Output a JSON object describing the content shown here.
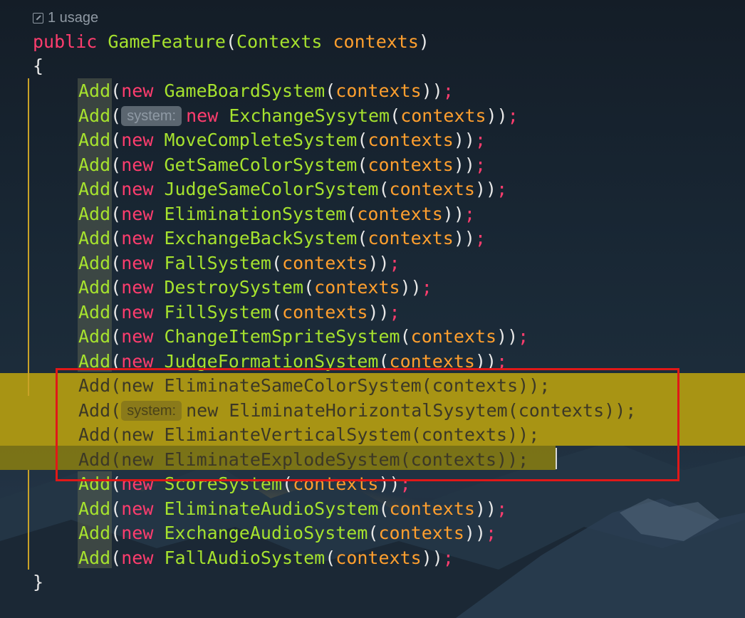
{
  "usage": {
    "icon": "usage-arrow-icon",
    "text": "1 usage"
  },
  "signature": {
    "modifier": "public",
    "name": "GameFeature",
    "param_type": "Contexts",
    "param_name": "contexts",
    "open_paren": "(",
    "close_paren": ")"
  },
  "open_brace": "{",
  "close_brace": "}",
  "statements": [
    {
      "call": "Add",
      "hint": "",
      "kw": "new",
      "system": "GameBoardSystem",
      "arg": "contexts"
    },
    {
      "call": "Add",
      "hint": "system:",
      "kw": "new",
      "system": "ExchangeSysytem",
      "arg": "contexts"
    },
    {
      "call": "Add",
      "hint": "",
      "kw": "new",
      "system": "MoveCompleteSystem",
      "arg": "contexts"
    },
    {
      "call": "Add",
      "hint": "",
      "kw": "new",
      "system": "GetSameColorSystem",
      "arg": "contexts"
    },
    {
      "call": "Add",
      "hint": "",
      "kw": "new",
      "system": "JudgeSameColorSystem",
      "arg": "contexts"
    },
    {
      "call": "Add",
      "hint": "",
      "kw": "new",
      "system": "EliminationSystem",
      "arg": "contexts"
    },
    {
      "call": "Add",
      "hint": "",
      "kw": "new",
      "system": "ExchangeBackSystem",
      "arg": "contexts"
    },
    {
      "call": "Add",
      "hint": "",
      "kw": "new",
      "system": "FallSystem",
      "arg": "contexts"
    },
    {
      "call": "Add",
      "hint": "",
      "kw": "new",
      "system": "DestroySystem",
      "arg": "contexts"
    },
    {
      "call": "Add",
      "hint": "",
      "kw": "new",
      "system": "FillSystem",
      "arg": "contexts"
    },
    {
      "call": "Add",
      "hint": "",
      "kw": "new",
      "system": "ChangeItemSpriteSystem",
      "arg": "contexts"
    },
    {
      "call": "Add",
      "hint": "",
      "kw": "new",
      "system": "JudgeFormationSystem",
      "arg": "contexts"
    },
    {
      "call": "Add",
      "hint": "",
      "kw": "new",
      "system": "EliminateSameColorSystem",
      "arg": "contexts",
      "highlighted": true
    },
    {
      "call": "Add",
      "hint": "system:",
      "kw": "new",
      "system": "EliminateHorizontalSysytem",
      "arg": "contexts",
      "highlighted": true
    },
    {
      "call": "Add",
      "hint": "",
      "kw": "new",
      "system": "ElimianteVerticalSystem",
      "arg": "contexts",
      "highlighted": true
    },
    {
      "call": "Add",
      "hint": "",
      "kw": "new",
      "system": "EliminateExplodeSystem",
      "arg": "contexts",
      "highlighted": true
    },
    {
      "call": "Add",
      "hint": "",
      "kw": "new",
      "system": "ScoreSystem",
      "arg": "contexts"
    },
    {
      "call": "Add",
      "hint": "",
      "kw": "new",
      "system": "EliminateAudioSystem",
      "arg": "contexts"
    },
    {
      "call": "Add",
      "hint": "",
      "kw": "new",
      "system": "ExchangeAudioSystem",
      "arg": "contexts"
    },
    {
      "call": "Add",
      "hint": "",
      "kw": "new",
      "system": "FallAudioSystem",
      "arg": "contexts"
    }
  ],
  "colors": {
    "keyword": "#ff3d6e",
    "identifier": "#a6e22e",
    "argument": "#ff9f2e",
    "selection_band": "#a89414",
    "annotation_box": "#e01818"
  }
}
